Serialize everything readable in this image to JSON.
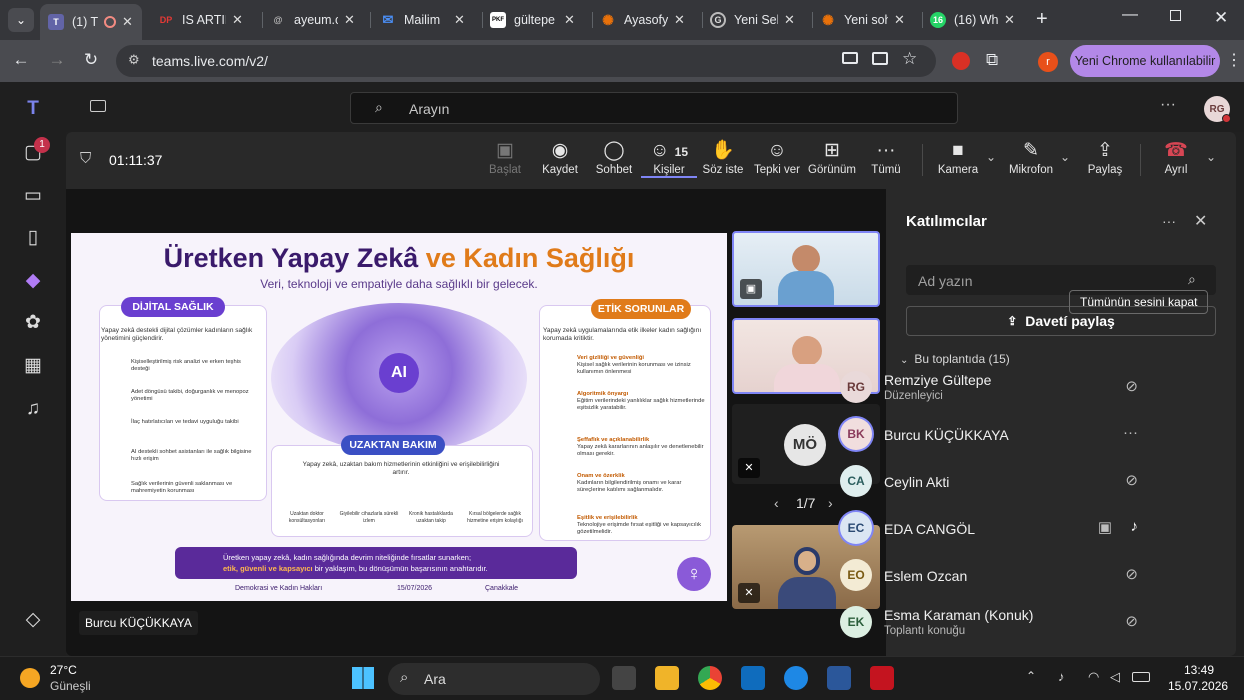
{
  "browser": {
    "tabs": [
      {
        "label": "(1) T",
        "fav": "T",
        "color": "#6264a7",
        "active": true
      },
      {
        "label": "IS ARTIF",
        "fav": "DP",
        "color": "#c0392b"
      },
      {
        "label": "ayeum.c",
        "fav": "@",
        "color": "#5a5a5a"
      },
      {
        "label": "Mailim",
        "fav": "M",
        "color": "#1a73e8"
      },
      {
        "label": "gültepe",
        "fav": "PKF",
        "color": "#ffffff"
      },
      {
        "label": "Ayasofy",
        "fav": "✺",
        "color": "#e8710a"
      },
      {
        "label": "Yeni Sek",
        "fav": "G",
        "color": "#9aa0a6"
      },
      {
        "label": "Yeni soh",
        "fav": "✺",
        "color": "#e8710a"
      },
      {
        "label": "(16) Wh",
        "fav": "16",
        "color": "#25d366"
      }
    ],
    "url": "teams.live.com/v2/",
    "profile_button": "Yeni Chrome kullanılabilir",
    "profile_initial": "r"
  },
  "teams": {
    "search_placeholder": "Arayın",
    "user_initials": "RG",
    "chat_badge": "1"
  },
  "meeting": {
    "timer": "01:11:37",
    "toolbar": {
      "start": "Başlat",
      "record": "Kaydet",
      "chat": "Sohbet",
      "people": "Kişiler",
      "people_count": "15",
      "raise": "Söz iste",
      "react": "Tepki ver",
      "view": "Görünüm",
      "more": "Tümü",
      "camera": "Kamera",
      "mic": "Mikrofon",
      "share": "Paylaş",
      "leave": "Ayrıl"
    },
    "presenter": "Burcu KÜÇÜKKAYA",
    "pager": "1/7",
    "tile_initials": "MÖ"
  },
  "slide": {
    "title_main": "Üretken Yapay Zekâ",
    "title_accent": "ve Kadın Sağlığı",
    "subtitle": "Veri, teknoloji ve empatiyle daha sağlıklı bir gelecek.",
    "center_ai": "AI",
    "left": {
      "tag": "DİJİTAL SAĞLIK",
      "intro": "Yapay zekâ destekli dijital çözümler kadınların sağlık yönetimini güçlendirir.",
      "items": [
        "Kişiselleştirilmiş risk analizi ve erken teşhis desteği",
        "Adet döngüsü takibi, doğurganlık ve menopoz yönetimi",
        "İlaç hatırlatıcıları ve tedavi uyguluğu takibi",
        "AI destekli sohbet asistanları ile sağlık bilgisine hızlı erişim",
        "Sağlık verilerinin güvenli saklanması ve mahremiyetin korunması"
      ]
    },
    "right": {
      "tag": "ETİK SORUNLAR",
      "intro": "Yapay zekâ uygulamalarında etik ilkeler kadın sağlığını korumada kritiktir.",
      "items": [
        {
          "h": "Veri gizliliği ve güvenliği",
          "t": "Kişisel sağlık verilerinin korunması ve izinsiz kullanımın önlenmesi"
        },
        {
          "h": "Algoritmik önyargı",
          "t": "Eğitim verilerindeki yanlılıklar sağlık hizmetlerinde eşitsizlik yaratabilir."
        },
        {
          "h": "Şeffaflık ve açıklanabilirlik",
          "t": "Yapay zekâ kararlarının anlaşılır ve denetlenebilir olması gerekir."
        },
        {
          "h": "Onam ve özerklik",
          "t": "Kadınların bilgilendirilmiş onamı ve karar süreçlerine katılımı sağlanmalıdır."
        },
        {
          "h": "Eşitlik ve erişilebilirlik",
          "t": "Teknolojiye erişimde fırsat eşitliği ve kapsayıcılık gözetilmelidir."
        }
      ]
    },
    "middle": {
      "tag": "UZAKTAN BAKIM",
      "intro": "Yapay zekâ, uzaktan bakım hizmetlerinin etkinliğini ve erişilebilirliğini artırır.",
      "items": [
        "Uzaktan doktor konsültasyonları",
        "Giyilebilir cihazlarla sürekli izlem",
        "Kronik hastalıklarda uzaktan takip",
        "Kırsal bölgelerde sağlık hizmetine erişim kolaylığı"
      ]
    },
    "footer_line1": "Üretken yapay zekâ, kadın sağlığında devrim niteliğinde fırsatlar sunarken;",
    "footer_line2_accent": "etik, güvenli ve kapsayıcı",
    "footer_line2_rest": "bir yaklaşım, bu dönüşümün başarısının anahtarıdır.",
    "info": [
      "Demokrasi ve Kadın Hakları",
      "15/07/2026",
      "Çanakkale"
    ]
  },
  "participants": {
    "title": "Katılımcılar",
    "search_placeholder": "Ad yazın",
    "invite": "Davetí paylaş",
    "section": "Bu toplantıda (15)",
    "mute_all": "Tümünün sesini kapat",
    "list": [
      {
        "initials": "RG",
        "name": "Remziye Gültepe",
        "role": "Düzenleyici",
        "bg": "#e9d9d9",
        "fg": "#6a3b3b",
        "action": "mic-off"
      },
      {
        "initials": "BK",
        "name": "Burcu KÜÇÜKKAYA",
        "role": "",
        "bg": "#f1dede",
        "fg": "#8a3b5b",
        "action": "more"
      },
      {
        "initials": "CA",
        "name": "Ceylin Akti",
        "role": "",
        "bg": "#dfeeee",
        "fg": "#2b5e5e",
        "action": "mic-off"
      },
      {
        "initials": "EC",
        "name": "EDA CANGÖL",
        "role": "",
        "bg": "#dbe6f3",
        "fg": "#2b4a73",
        "action": "mic-on"
      },
      {
        "initials": "EO",
        "name": "Eslem Ozcan",
        "role": "",
        "bg": "#f3ebd4",
        "fg": "#7a5a13",
        "action": "mic-off"
      },
      {
        "initials": "EK",
        "name": "Esma Karaman (Konuk)",
        "role": "Toplantı konuğu",
        "bg": "#dcefe2",
        "fg": "#2b5e3b",
        "action": "mic-off"
      }
    ]
  },
  "taskbar": {
    "weather_temp": "27°C",
    "weather_desc": "Güneşli",
    "search": "Ara",
    "time": "13:49",
    "date": "15.07.2026"
  }
}
